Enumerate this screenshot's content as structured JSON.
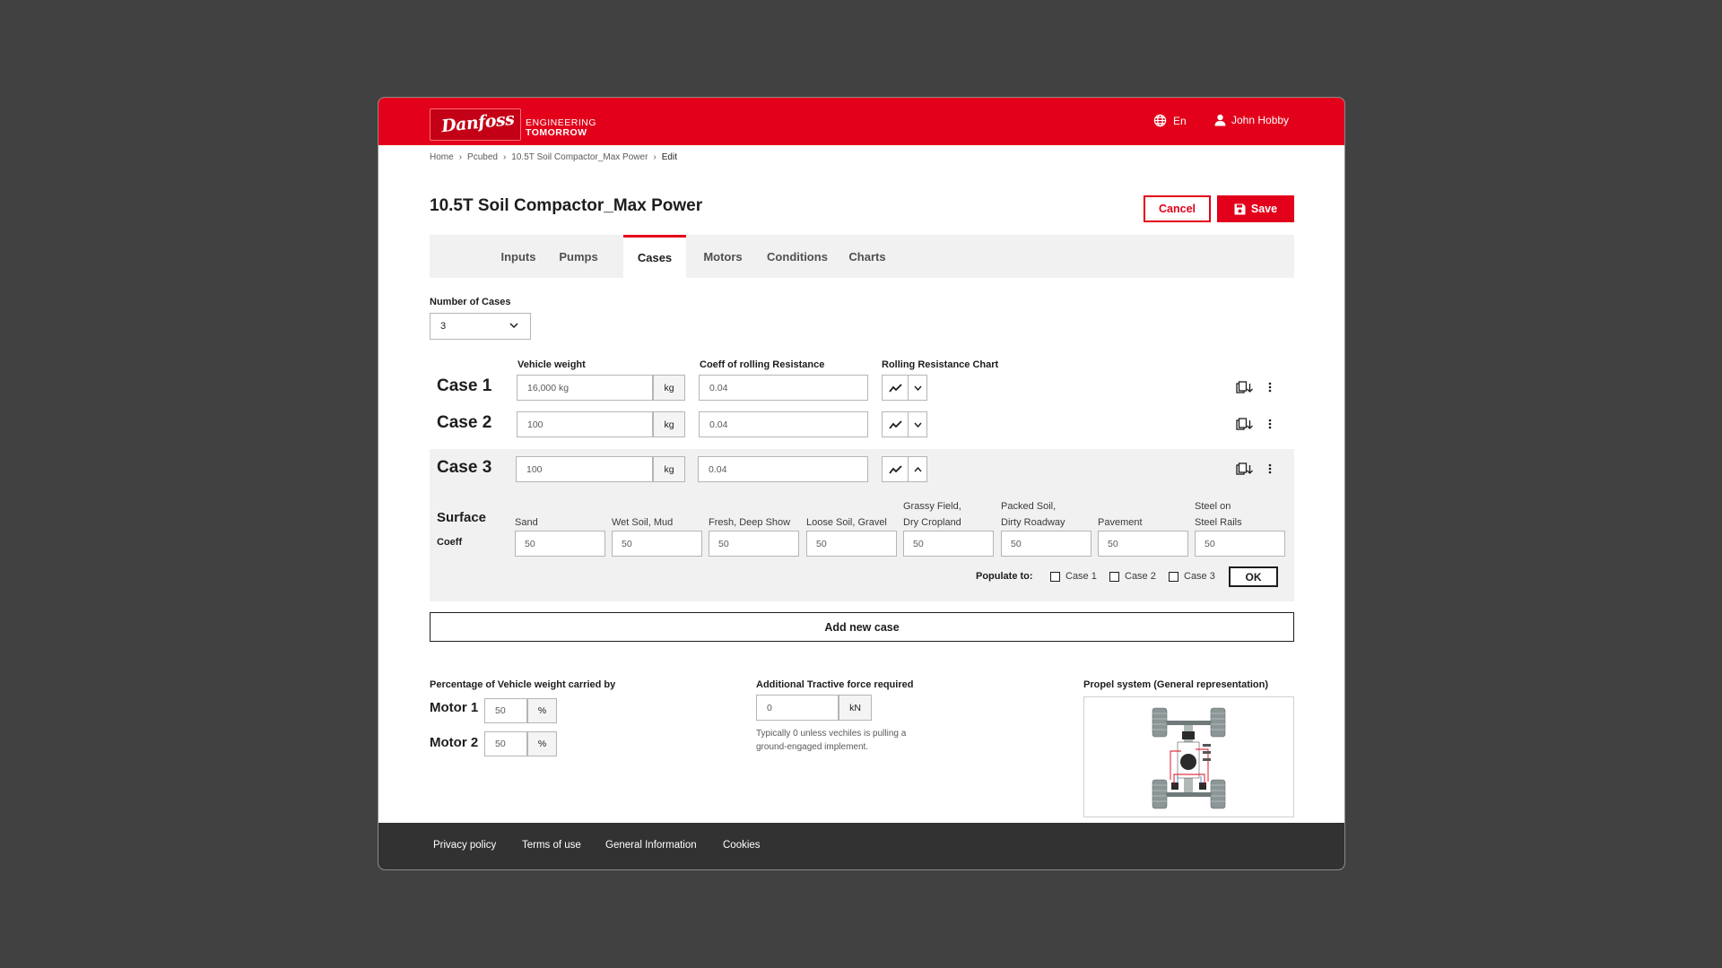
{
  "header": {
    "logo_text": "Danfoss",
    "tagline_top": "ENGINEERING",
    "tagline_bottom": "TOMORROW",
    "language": "En",
    "user_name": "John Hobby",
    "colors": {
      "brand": "#e2001a",
      "footer": "#323232"
    }
  },
  "breadcrumb": [
    "Home",
    "Pcubed",
    "10.5T Soil Compactor_Max Power",
    "Edit"
  ],
  "page": {
    "title": "10.5T Soil Compactor_Max Power",
    "cancel_label": "Cancel",
    "save_label": "Save"
  },
  "tabs": [
    {
      "label": "Inputs",
      "active": false
    },
    {
      "label": "Pumps",
      "active": false
    },
    {
      "label": "Cases",
      "active": true
    },
    {
      "label": "Motors",
      "active": false
    },
    {
      "label": "Conditions",
      "active": false
    },
    {
      "label": "Charts",
      "active": false
    }
  ],
  "cases_section": {
    "number_label": "Number of Cases",
    "number_value": "3",
    "col_vehicle_weight": "Vehicle weight",
    "col_coeff": "Coeff of rolling Resistance",
    "col_chart": "Rolling Resistance Chart",
    "cases": [
      {
        "name": "Case 1",
        "weight": "16,000 kg",
        "unit": "kg",
        "coeff": "0.04",
        "expanded": false
      },
      {
        "name": "Case 2",
        "weight": "100",
        "unit": "kg",
        "coeff": "0.04",
        "expanded": false
      },
      {
        "name": "Case 3",
        "weight": "100",
        "unit": "kg",
        "coeff": "0.04",
        "expanded": true
      }
    ],
    "surface": {
      "title": "Surface",
      "coeff_label": "Coeff",
      "items": [
        {
          "l1": "",
          "l2": "Sand",
          "value": "50"
        },
        {
          "l1": "",
          "l2": "Wet Soil, Mud",
          "value": "50"
        },
        {
          "l1": "",
          "l2": "Fresh, Deep Show",
          "value": "50"
        },
        {
          "l1": "",
          "l2": "Loose Soil,  Gravel",
          "value": "50"
        },
        {
          "l1": "Grassy Field,",
          "l2": "Dry Cropland",
          "value": "50"
        },
        {
          "l1": "Packed Soil,",
          "l2": "Dirty Roadway",
          "value": "50"
        },
        {
          "l1": "",
          "l2": "Pavement",
          "value": "50"
        },
        {
          "l1": "Steel on",
          "l2": "Steel Rails",
          "value": "50"
        }
      ]
    },
    "populate": {
      "label": "Populate to:",
      "options": [
        "Case 1",
        "Case 2",
        "Case 3"
      ],
      "ok_label": "OK"
    },
    "add_case_label": "Add new case"
  },
  "motors": {
    "title": "Percentage of Vehicle weight carried by",
    "items": [
      {
        "name": "Motor 1",
        "value": "50",
        "unit": "%"
      },
      {
        "name": "Motor 2",
        "value": "50",
        "unit": "%"
      }
    ]
  },
  "tractive": {
    "title": "Additional Tractive force required",
    "value": "0",
    "unit": "kN",
    "hint": "Typically 0 unless vechiles is pulling a ground-engaged implement."
  },
  "propel": {
    "title": "Propel system (General representation)"
  },
  "footer": {
    "links": [
      "Privacy policy",
      "Terms of use",
      "General Information",
      "Cookies"
    ]
  }
}
